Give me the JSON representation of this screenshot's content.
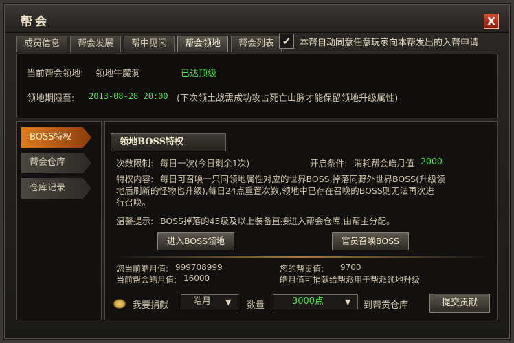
{
  "window": {
    "title": "帮会",
    "close_glyph": "X"
  },
  "tabs": [
    {
      "label": "成员信息"
    },
    {
      "label": "帮会发展"
    },
    {
      "label": "帮中见闻"
    },
    {
      "label": "帮会领地"
    },
    {
      "label": "帮会列表"
    }
  ],
  "auto_join": {
    "checked_glyph": "✔",
    "label": "本帮自动同意任意玩家向本帮发出的入帮申请"
  },
  "territory": {
    "current_label": "当前帮会领地:",
    "current_value": "领地牛魔洞",
    "level_status": "已达顶级",
    "expire_label": "领地期限至:",
    "expire_value": "2013-08-28  20:00",
    "expire_note": "(下次领土战需成功攻占死亡山脉才能保留领地升级属性)"
  },
  "side_menu": [
    {
      "label": "BOSS特权"
    },
    {
      "label": "帮会仓库"
    },
    {
      "label": "仓库记录"
    }
  ],
  "boss": {
    "section_title": "领地BOSS特权",
    "limit_label": "次数限制:",
    "limit_value": "每日一次(今日剩余1次)",
    "open_label": "开启条件:",
    "open_value": "消耗帮会皓月值",
    "open_amount": "2000",
    "content_label": "特权内容:",
    "content_line1": "每日可召唤一只同领地属性对应的世界BOSS,掉落同野外世界BOSS(升级领",
    "content_line2": "地后刷新的怪物也升级),每日24点重置次数,领地中已存在召唤的BOSS则无法再次进",
    "content_line3": "行召唤。",
    "tip_label": "温馨提示:",
    "tip_value": "BOSS掉落的45级及以上装备直接进入帮会仓库,由帮主分配。",
    "enter_button": "进入BOSS领地",
    "summon_button": "官员召唤BOSS"
  },
  "stats": {
    "my_moon_label": "您当前皓月值:",
    "my_moon_value": "999708999",
    "guild_moon_label": "当前帮会皓月值:",
    "guild_moon_value": "16000",
    "contrib_label": "您的帮贡值:",
    "contrib_value": "9700",
    "contrib_note": "皓月值可捐献给帮派用于帮派领地升级"
  },
  "donate": {
    "label": "我要捐献",
    "type_value": "皓月",
    "qty_label": "数量",
    "qty_value": "3000点",
    "dest_label": "到帮贡仓库",
    "submit_button": "提交贡献"
  },
  "colors": {
    "green": "#4fe04a",
    "accent_orange": "#e07a1f"
  }
}
